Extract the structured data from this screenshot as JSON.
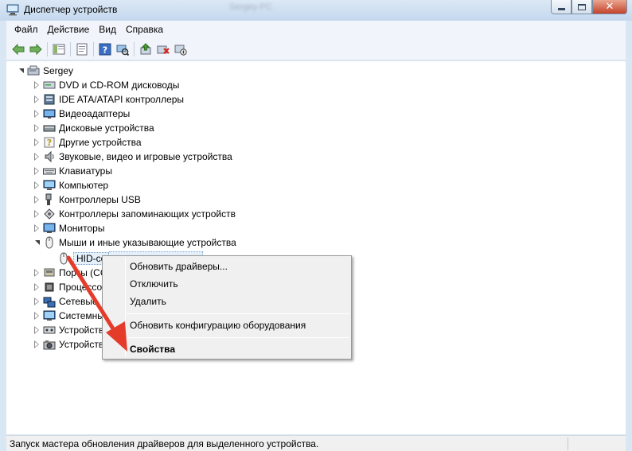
{
  "window": {
    "title": "Диспетчер устройств",
    "blurred_caption": "Sergey-PC",
    "colors": {
      "title_gradient_top": "#dbe8f5",
      "close_button": "#c4432b",
      "arrow": "#e53b2a"
    }
  },
  "menu": {
    "items": [
      "Файл",
      "Действие",
      "Вид",
      "Справка"
    ]
  },
  "toolbar": {
    "buttons": [
      "back-icon",
      "forward-icon",
      "show-hide-tree-icon",
      "properties-icon",
      "help-icon",
      "scan-hardware-icon",
      "update-driver-icon",
      "uninstall-icon",
      "disable-icon"
    ]
  },
  "tree": {
    "root": "Sergey",
    "nodes": [
      {
        "label": "DVD и CD-ROM дисководы",
        "icon": "dvd-drive-icon"
      },
      {
        "label": "IDE ATA/ATAPI контроллеры",
        "icon": "ide-controller-icon"
      },
      {
        "label": "Видеоадаптеры",
        "icon": "display-adapter-icon"
      },
      {
        "label": "Дисковые устройства",
        "icon": "disk-drive-icon"
      },
      {
        "label": "Другие устройства",
        "icon": "unknown-device-icon"
      },
      {
        "label": "Звуковые, видео и игровые устройства",
        "icon": "speaker-icon"
      },
      {
        "label": "Клавиатуры",
        "icon": "keyboard-icon"
      },
      {
        "label": "Компьютер",
        "icon": "computer-icon"
      },
      {
        "label": "Контроллеры USB",
        "icon": "usb-icon"
      },
      {
        "label": "Контроллеры запоминающих устройств",
        "icon": "storage-controller-icon"
      },
      {
        "label": "Мониторы",
        "icon": "monitor-icon"
      },
      {
        "label": "Мыши и иные указывающие устройства",
        "icon": "mouse-icon"
      }
    ],
    "child": "HID-co",
    "partial_nodes": [
      {
        "label": "Порты (СС",
        "icon": "port-icon"
      },
      {
        "label": "Процессо",
        "icon": "processor-icon"
      },
      {
        "label": "Сетевые",
        "icon": "network-adapter-icon"
      },
      {
        "label": "Системны",
        "icon": "system-device-icon"
      },
      {
        "label": "Устройств",
        "icon": "hid-icon"
      },
      {
        "label": "Устройств",
        "icon": "imaging-device-icon"
      }
    ]
  },
  "context_menu": {
    "items": [
      {
        "label": "Обновить драйверы..."
      },
      {
        "label": "Отключить"
      },
      {
        "label": "Удалить"
      },
      {
        "label": "Обновить конфигурацию оборудования"
      },
      {
        "label": "Свойства",
        "bold": true
      }
    ]
  },
  "status": {
    "text": "Запуск мастера обновления драйверов для выделенного устройства."
  }
}
